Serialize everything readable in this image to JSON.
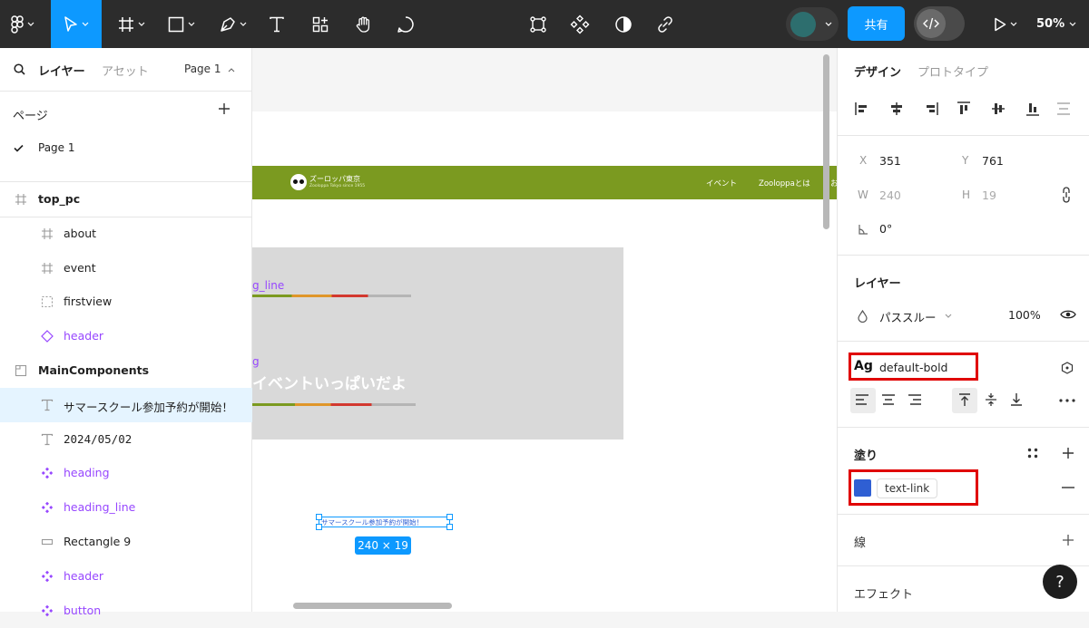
{
  "toolbar": {
    "share_label": "共有",
    "zoom_label": "50%",
    "colors": {
      "bg": "#2c2c2c",
      "accent": "#0d99ff"
    },
    "icons": [
      "figma-menu-icon",
      "move-tool-icon",
      "frame-tool-icon",
      "shape-tool-icon",
      "pen-tool-icon",
      "text-tool-icon",
      "actions-icon",
      "hand-tool-icon",
      "comment-tool-icon",
      "component-edit-icon",
      "component-icon",
      "mask-icon",
      "link-icon",
      "dev-mode-icon",
      "play-icon"
    ]
  },
  "left_panel": {
    "tab_layers": "レイヤー",
    "tab_assets": "アセット",
    "page_selector": "Page 1",
    "pages_title": "ページ",
    "current_page": "Page 1",
    "layers": [
      {
        "label": "top_pc",
        "icon": "frame-icon",
        "indent": 0,
        "bold": true,
        "purple": false,
        "mono": false
      },
      {
        "label": "about",
        "icon": "frame-icon",
        "indent": 1,
        "bold": false,
        "purple": false,
        "mono": false
      },
      {
        "label": "event",
        "icon": "frame-icon",
        "indent": 1,
        "bold": false,
        "purple": false,
        "mono": false
      },
      {
        "label": "firstview",
        "icon": "section-dashed-icon",
        "indent": 1,
        "bold": false,
        "purple": false,
        "mono": false
      },
      {
        "label": "header",
        "icon": "instance-icon",
        "indent": 1,
        "bold": false,
        "purple": true,
        "mono": false
      },
      {
        "label": "MainComponents",
        "icon": "section-icon",
        "indent": 0,
        "bold": true,
        "purple": false,
        "mono": false
      },
      {
        "label": "サマースクール参加予約が開始！",
        "icon": "text-icon",
        "indent": 1,
        "bold": false,
        "purple": false,
        "mono": false,
        "selected": true
      },
      {
        "label": "2024/05/02",
        "icon": "text-icon",
        "indent": 1,
        "bold": false,
        "purple": false,
        "mono": true
      },
      {
        "label": "heading",
        "icon": "component-icon",
        "indent": 1,
        "bold": false,
        "purple": true,
        "mono": false
      },
      {
        "label": "heading_line",
        "icon": "component-icon",
        "indent": 1,
        "bold": false,
        "purple": true,
        "mono": false
      },
      {
        "label": "Rectangle 9",
        "icon": "rectangle-icon",
        "indent": 1,
        "bold": false,
        "purple": false,
        "mono": false
      },
      {
        "label": "header",
        "icon": "component-icon",
        "indent": 1,
        "bold": false,
        "purple": true,
        "mono": false
      },
      {
        "label": "button",
        "icon": "component-icon",
        "indent": 1,
        "bold": false,
        "purple": true,
        "mono": false
      }
    ]
  },
  "canvas": {
    "site_title": "ズーロッパ東京",
    "site_subtitle": "Zooloppa Tokyo since 1955",
    "nav_event": "イベント",
    "nav_about": "Zooloppaとは",
    "nav_more": "お",
    "label_heading_line": "g_line",
    "label_heading": "g",
    "heading_text": "イベントいっぱいだよ",
    "selected_text": "サマースクール参加予約が開始！",
    "size_badge": "240 × 19",
    "header_color": "#7b9a20"
  },
  "right_panel": {
    "tab_design": "デザイン",
    "tab_prototype": "プロトタイプ",
    "x_label": "X",
    "x_value": "351",
    "y_label": "Y",
    "y_value": "761",
    "w_label": "W",
    "w_value": "240",
    "h_label": "H",
    "h_value": "19",
    "rotation_value": "0°",
    "layer_heading": "レイヤー",
    "blend_mode": "パススルー",
    "opacity": "100%",
    "text_style_prefix": "Ag",
    "text_style": "default-bold",
    "fill_heading": "塗り",
    "fill_style": "text-link",
    "fill_color": "#2f5fd3",
    "stroke_heading": "線",
    "effects_heading": "エフェクト",
    "help_label": "?"
  }
}
